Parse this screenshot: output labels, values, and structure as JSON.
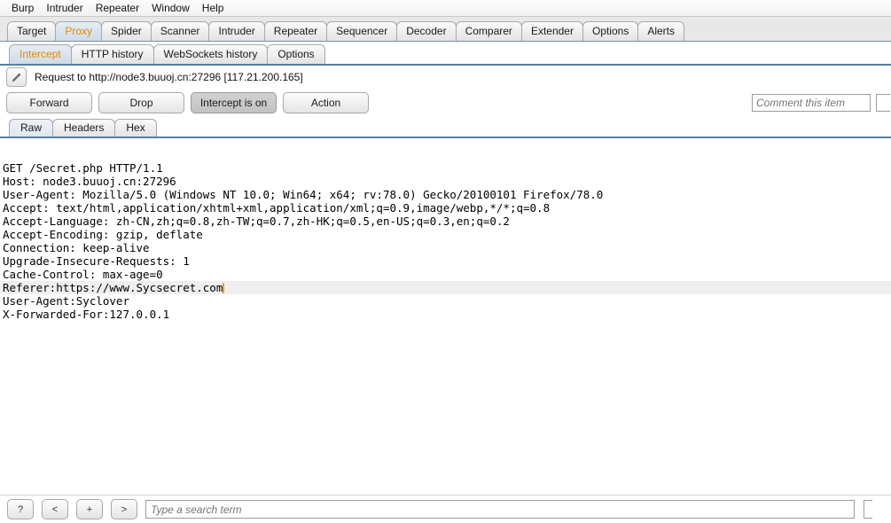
{
  "menu": {
    "items": [
      "Burp",
      "Intruder",
      "Repeater",
      "Window",
      "Help"
    ]
  },
  "main_tabs": {
    "selected": "Proxy",
    "items": [
      "Target",
      "Proxy",
      "Spider",
      "Scanner",
      "Intruder",
      "Repeater",
      "Sequencer",
      "Decoder",
      "Comparer",
      "Extender",
      "Options",
      "Alerts"
    ]
  },
  "sub_tabs": {
    "selected": "Intercept",
    "items": [
      "Intercept",
      "HTTP history",
      "WebSockets history",
      "Options"
    ]
  },
  "request_info": {
    "icon": "pencil-icon",
    "text": "Request to http://node3.buuoj.cn:27296  [117.21.200.165]"
  },
  "actions": {
    "forward": "Forward",
    "drop": "Drop",
    "intercept_toggle": "Intercept is on",
    "intercept_state": "on",
    "action": "Action",
    "comment_placeholder": "Comment this item",
    "comment_value": ""
  },
  "view_tabs": {
    "selected": "Raw",
    "items": [
      "Raw",
      "Headers",
      "Hex"
    ]
  },
  "request": {
    "lines": [
      {
        "text": "GET /Secret.php HTTP/1.1",
        "highlight": false
      },
      {
        "text": "Host: node3.buuoj.cn:27296",
        "highlight": false
      },
      {
        "text": "User-Agent: Mozilla/5.0 (Windows NT 10.0; Win64; x64; rv:78.0) Gecko/20100101 Firefox/78.0",
        "highlight": false
      },
      {
        "text": "Accept: text/html,application/xhtml+xml,application/xml;q=0.9,image/webp,*/*;q=0.8",
        "highlight": false
      },
      {
        "text": "Accept-Language: zh-CN,zh;q=0.8,zh-TW;q=0.7,zh-HK;q=0.5,en-US;q=0.3,en;q=0.2",
        "highlight": false
      },
      {
        "text": "Accept-Encoding: gzip, deflate",
        "highlight": false
      },
      {
        "text": "Connection: keep-alive",
        "highlight": false
      },
      {
        "text": "Upgrade-Insecure-Requests: 1",
        "highlight": false
      },
      {
        "text": "Cache-Control: max-age=0",
        "highlight": false
      },
      {
        "text": "Referer:https://www.Sycsecret.com",
        "highlight": true,
        "caret": true
      },
      {
        "text": "User-Agent:Syclover",
        "highlight": false
      },
      {
        "text": "X-Forwarded-For:127.0.0.1",
        "highlight": false
      }
    ]
  },
  "search_bar": {
    "help_button": "?",
    "prev_button": "<",
    "add_button": "+",
    "next_button": ">",
    "placeholder": "Type a search term",
    "value": ""
  },
  "colors": {
    "selected_tab_text": "#e58900",
    "tab_underline": "#5b7da1",
    "caret": "#e8a33d",
    "highlight_row": "#efefef"
  }
}
